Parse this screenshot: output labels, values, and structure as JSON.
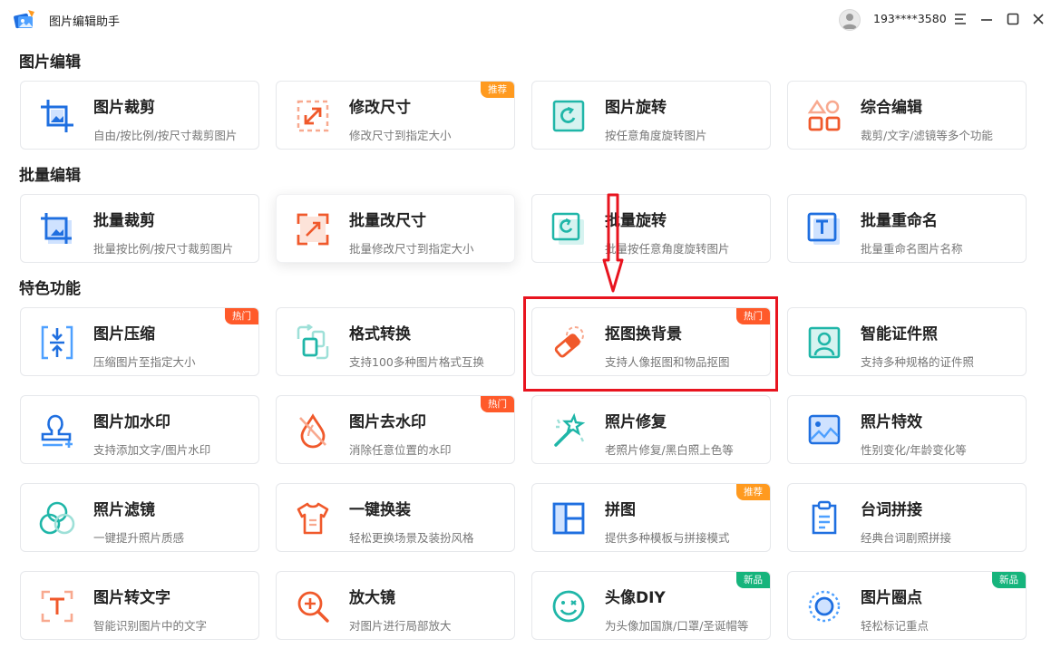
{
  "titlebar": {
    "app_title": "图片编辑助手",
    "user_id": "193****3580",
    "icons": [
      "app-logo",
      "avatar",
      "menu-icon",
      "minimize-icon",
      "maximize-icon",
      "close-icon"
    ]
  },
  "sections": [
    {
      "title": "图片编辑",
      "cards": [
        {
          "title": "图片裁剪",
          "desc": "自由/按比例/按尺寸裁剪图片",
          "icon": "crop-icon",
          "badge": ""
        },
        {
          "title": "修改尺寸",
          "desc": "修改尺寸到指定大小",
          "icon": "resize-icon",
          "badge": "推荐"
        },
        {
          "title": "图片旋转",
          "desc": "按任意角度旋转图片",
          "icon": "rotate-icon",
          "badge": ""
        },
        {
          "title": "综合编辑",
          "desc": "裁剪/文字/滤镜等多个功能",
          "icon": "shapes-icon",
          "badge": ""
        }
      ]
    },
    {
      "title": "批量编辑",
      "cards": [
        {
          "title": "批量裁剪",
          "desc": "批量按比例/按尺寸裁剪图片",
          "icon": "batch-crop-icon",
          "badge": ""
        },
        {
          "title": "批量改尺寸",
          "desc": "批量修改尺寸到指定大小",
          "icon": "batch-resize-icon",
          "badge": ""
        },
        {
          "title": "批量旋转",
          "desc": "批量按任意角度旋转图片",
          "icon": "batch-rotate-icon",
          "badge": ""
        },
        {
          "title": "批量重命名",
          "desc": "批量重命名图片名称",
          "icon": "rename-icon",
          "badge": ""
        }
      ]
    },
    {
      "title": "特色功能",
      "cards": [
        {
          "title": "图片压缩",
          "desc": "压缩图片至指定大小",
          "icon": "compress-icon",
          "badge": "热门"
        },
        {
          "title": "格式转换",
          "desc": "支持100多种图片格式互换",
          "icon": "convert-icon",
          "badge": ""
        },
        {
          "title": "抠图换背景",
          "desc": "支持人像抠图和物品抠图",
          "icon": "eraser-icon",
          "badge": "热门"
        },
        {
          "title": "智能证件照",
          "desc": "支持多种规格的证件照",
          "icon": "id-photo-icon",
          "badge": ""
        },
        {
          "title": "图片加水印",
          "desc": "支持添加文字/图片水印",
          "icon": "add-watermark-icon",
          "badge": ""
        },
        {
          "title": "图片去水印",
          "desc": "消除任意位置的水印",
          "icon": "remove-watermark-icon",
          "badge": "热门"
        },
        {
          "title": "照片修复",
          "desc": "老照片修复/黑白照上色等",
          "icon": "magic-wand-icon",
          "badge": ""
        },
        {
          "title": "照片特效",
          "desc": "性别变化/年龄变化等",
          "icon": "photo-effect-icon",
          "badge": ""
        },
        {
          "title": "照片滤镜",
          "desc": "一键提升照片质感",
          "icon": "filter-icon",
          "badge": ""
        },
        {
          "title": "一键换装",
          "desc": "轻松更换场景及装扮风格",
          "icon": "shirt-icon",
          "badge": ""
        },
        {
          "title": "拼图",
          "desc": "提供多种模板与拼接模式",
          "icon": "collage-icon",
          "badge": "推荐"
        },
        {
          "title": "台词拼接",
          "desc": "经典台词剧照拼接",
          "icon": "clipboard-icon",
          "badge": ""
        },
        {
          "title": "图片转文字",
          "desc": "智能识别图片中的文字",
          "icon": "ocr-icon",
          "badge": ""
        },
        {
          "title": "放大镜",
          "desc": "对图片进行局部放大",
          "icon": "magnifier-icon",
          "badge": ""
        },
        {
          "title": "头像DIY",
          "desc": "为头像加国旗/口罩/圣诞帽等",
          "icon": "smiley-icon",
          "badge": "新品"
        },
        {
          "title": "图片圈点",
          "desc": "轻松标记重点",
          "icon": "circle-mark-icon",
          "badge": "新品"
        }
      ]
    }
  ],
  "colors": {
    "blue": "#1f6fe0",
    "orange": "#f0592b",
    "teal": "#1fb6a8",
    "highlight": "#e8141f"
  }
}
